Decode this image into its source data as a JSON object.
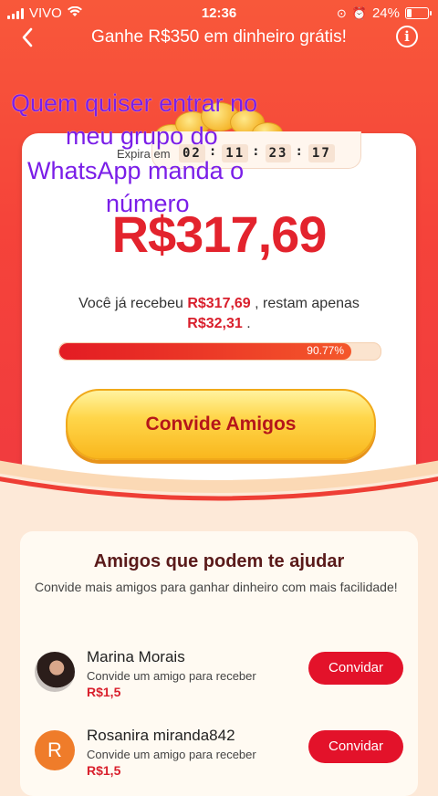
{
  "status_bar": {
    "carrier": "VIVO",
    "time": "12:36",
    "battery": "24%",
    "battery_level": 0.24
  },
  "header": {
    "title": "Ganhe R$350 em dinheiro grátis!",
    "back_icon": "chevron-left-icon",
    "info_icon": "info-icon"
  },
  "card": {
    "expire_label": "Expira em",
    "timer": [
      "02",
      "11",
      "23",
      "17"
    ],
    "amount": "R$317,69",
    "received_prefix": "Você já recebeu",
    "received_amount": "R$317,69",
    "received_middle": ", restam apenas",
    "remaining_amount": "R$32,31",
    "received_suffix": ".",
    "progress_percent_text": "90.77%",
    "progress_value": 90.77,
    "invite_button": "Convide Amigos"
  },
  "overlay_text": {
    "line1": "Quem quiser entrar no",
    "line2": "meu grupo do",
    "line3": "WhatsApp manda o",
    "line4": "número"
  },
  "friends": {
    "title": "Amigos que podem te ajudar",
    "subtitle": "Convide mais amigos para ganhar dinheiro com mais facilidade!",
    "items": [
      {
        "name": "Marina Morais",
        "desc": "Convide um amigo para receber",
        "prize": "R$1,5",
        "button": "Convidar",
        "avatar": "photo"
      },
      {
        "name": "Rosanira miranda842",
        "desc": "Convide um amigo para receber",
        "prize": "R$1,5",
        "button": "Convidar",
        "avatar_letter": "R"
      }
    ]
  },
  "colors": {
    "accent_red": "#e3232d",
    "header_bg": "#f5433a",
    "button_yellow": "#ffd64a",
    "overlay_purple": "#7a1ee8"
  }
}
